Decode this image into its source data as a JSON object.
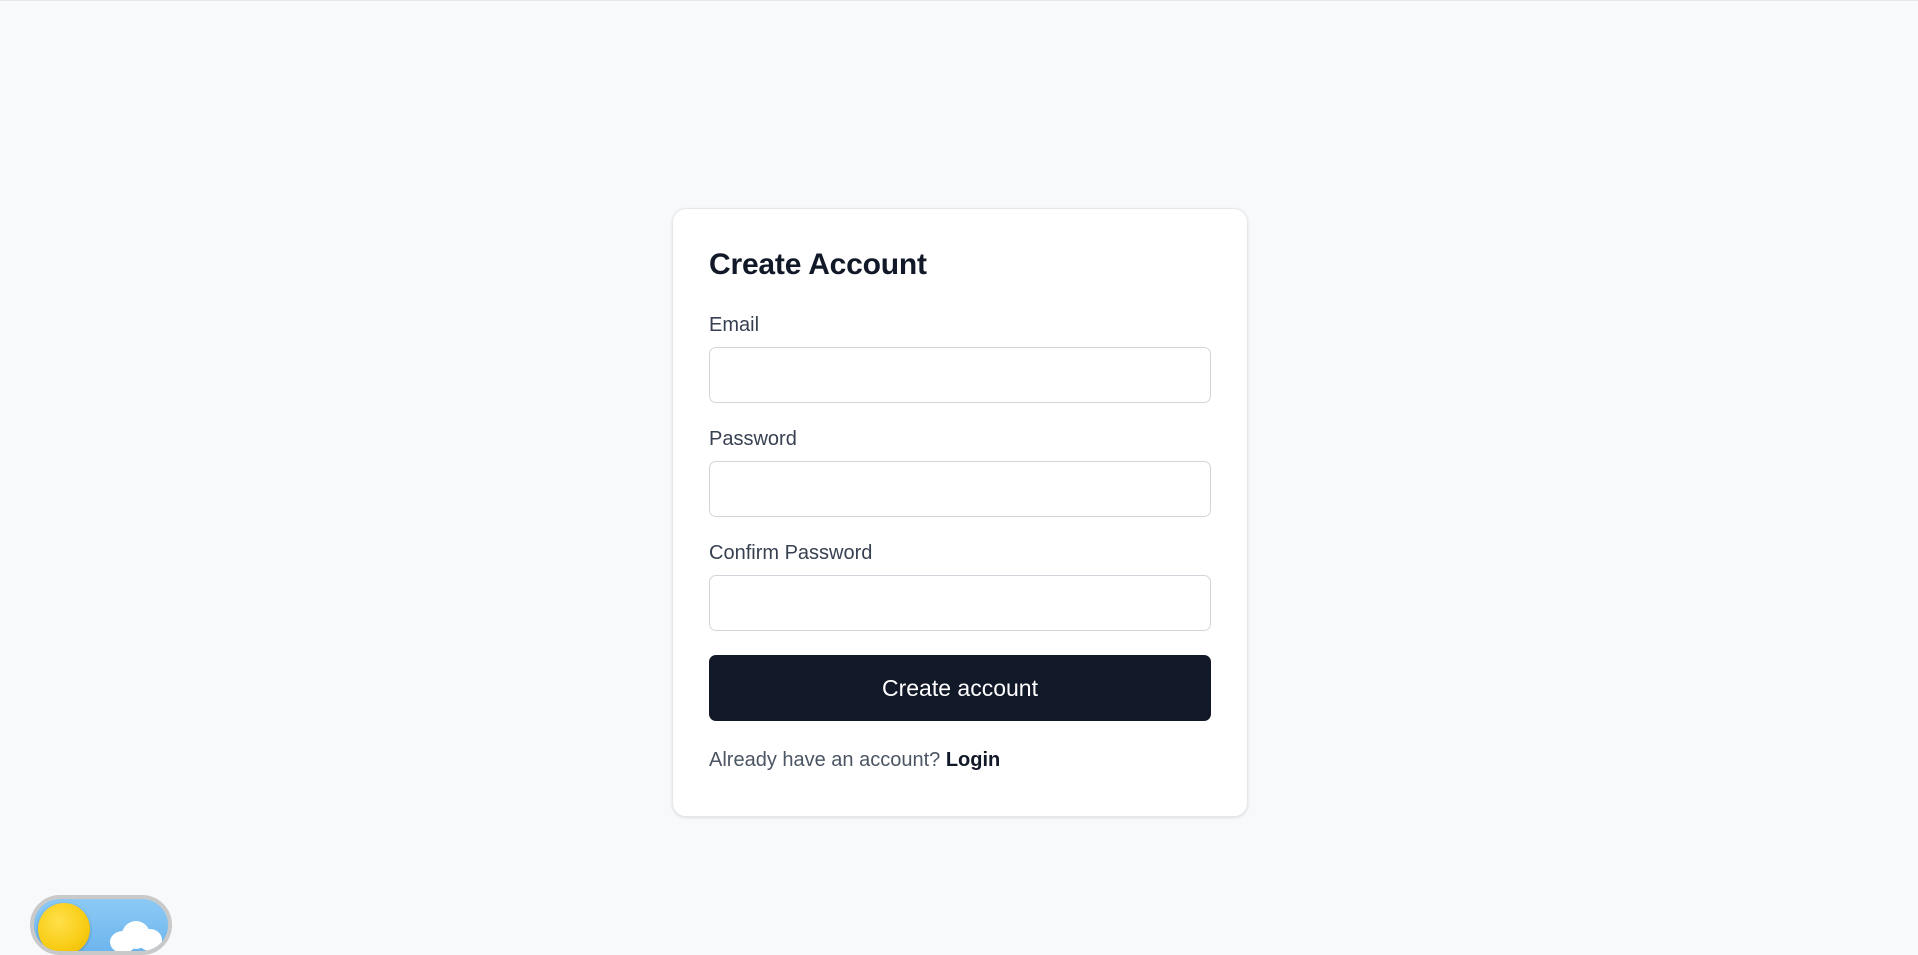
{
  "form": {
    "title": "Create Account",
    "fields": [
      {
        "label": "Email",
        "value": ""
      },
      {
        "label": "Password",
        "value": ""
      },
      {
        "label": "Confirm Password",
        "value": ""
      }
    ],
    "submit_label": "Create account",
    "footer_text": "Already have an account?",
    "login_link": "Login"
  },
  "theme_toggle": {
    "icons": [
      "sun-icon",
      "cloud-icon"
    ]
  },
  "colors": {
    "page_background": "#f8f9fb",
    "card_background": "#ffffff",
    "primary_button": "#111827",
    "heading_text": "#111827",
    "label_text": "#374151",
    "muted_text": "#4b5563",
    "input_border": "#d1d5db",
    "toggle_sky": "#7cc0f2",
    "toggle_sun": "#f8cc13"
  }
}
